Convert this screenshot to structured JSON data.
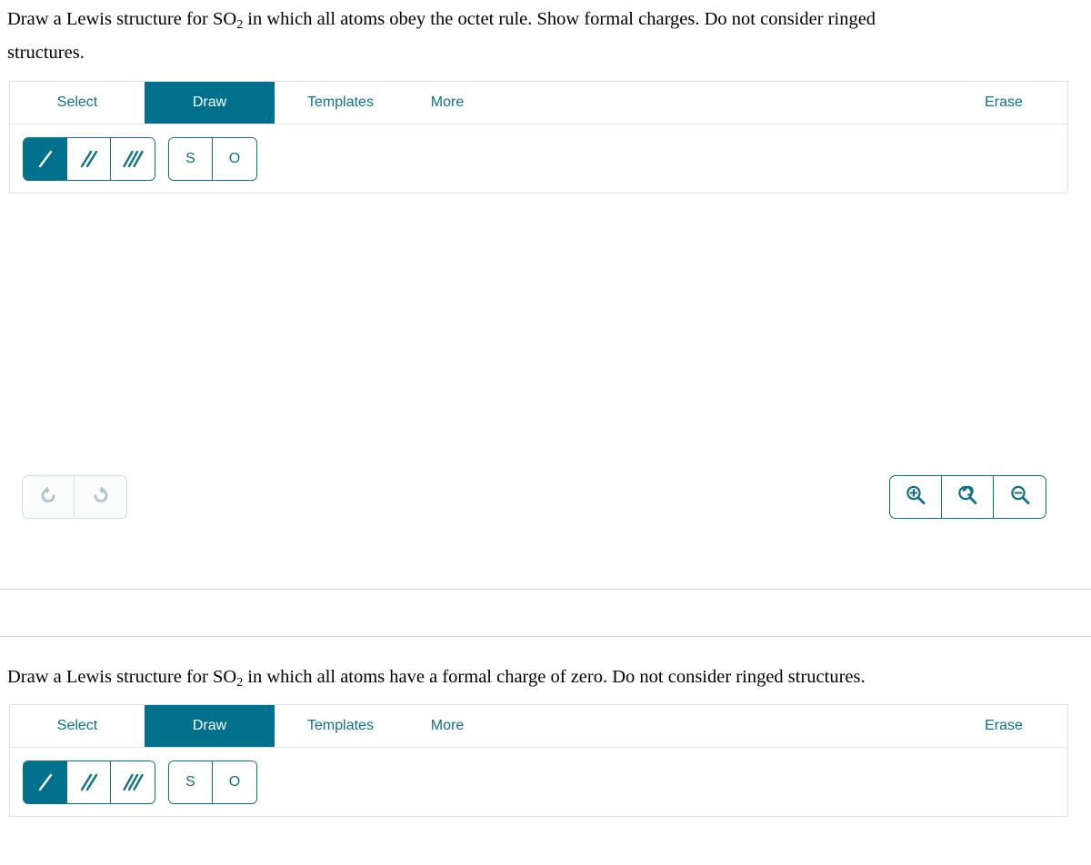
{
  "questions": [
    {
      "id": "q1",
      "text_before": "Draw a Lewis structure for ",
      "formula_base": "SO",
      "formula_sub": "2",
      "text_after": " in which all atoms obey the octet rule. Show formal charges. Do not consider ringed structures."
    },
    {
      "id": "q2",
      "text_before": "Draw a Lewis structure for ",
      "formula_base": "SO",
      "formula_sub": "2",
      "text_after": " in which all atoms have a formal charge of zero. Do not consider ringed structures."
    }
  ],
  "editor": {
    "tabs": [
      {
        "label": "Select",
        "name": "tab-select",
        "active": false
      },
      {
        "label": "Draw",
        "name": "tab-draw",
        "active": true
      },
      {
        "label": "Templates",
        "name": "tab-templates",
        "active": false
      },
      {
        "label": "More",
        "name": "tab-more",
        "active": false
      }
    ],
    "erase_label": "Erase",
    "bond_tools": [
      {
        "name": "single-bond-tool",
        "icon": "single-bond-icon",
        "active": true
      },
      {
        "name": "double-bond-tool",
        "icon": "double-bond-icon",
        "active": false
      },
      {
        "name": "triple-bond-tool",
        "icon": "triple-bond-icon",
        "active": false
      }
    ],
    "atom_tools": [
      {
        "label": "S",
        "name": "atom-tool-sulfur"
      },
      {
        "label": "O",
        "name": "atom-tool-oxygen"
      }
    ],
    "history_tools": [
      {
        "name": "undo-button",
        "icon": "undo-icon"
      },
      {
        "name": "redo-button",
        "icon": "redo-icon"
      }
    ],
    "zoom_tools": [
      {
        "name": "zoom-in-button",
        "icon": "zoom-in-icon"
      },
      {
        "name": "zoom-reset-button",
        "icon": "zoom-reset-icon"
      },
      {
        "name": "zoom-out-button",
        "icon": "zoom-out-icon"
      }
    ]
  },
  "colors": {
    "accent": "#00718d",
    "accent_text": "#0d718d",
    "panel_border": "#e0e0e0",
    "disabled_icon": "#a8c4d0",
    "divider": "#d4d4d4"
  }
}
